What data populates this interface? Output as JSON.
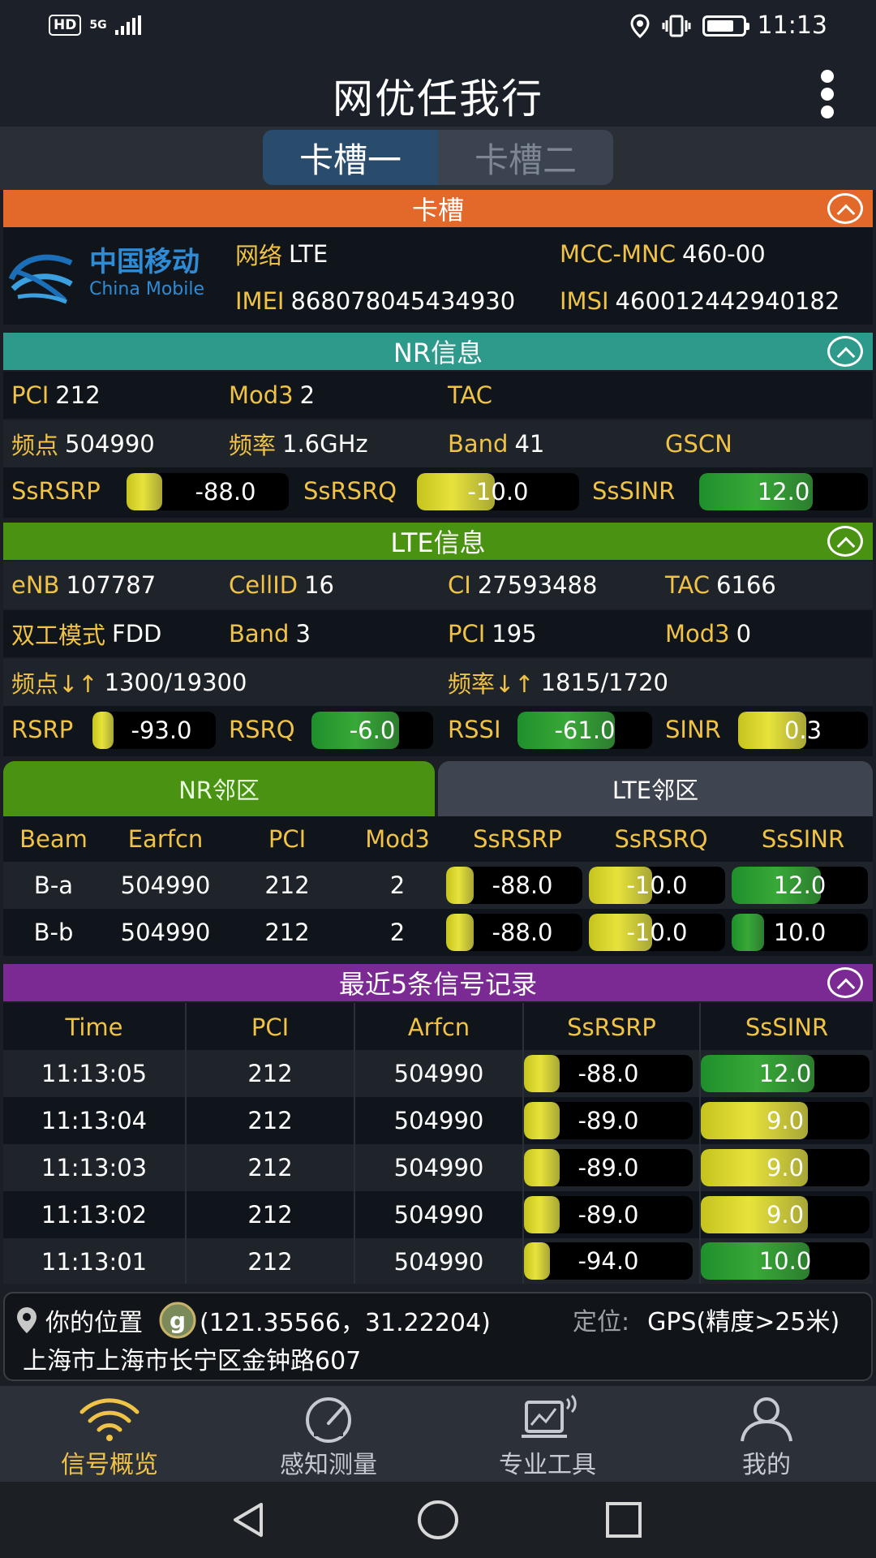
{
  "status_bar": {
    "hd": "HD",
    "network": "5G",
    "time": "11:13"
  },
  "app": {
    "title": "网优任我行"
  },
  "sim_tabs": [
    "卡槽一",
    "卡槽二"
  ],
  "sim_section": {
    "title": "卡槽",
    "logo": {
      "cn": "中国移动",
      "en": "China Mobile"
    },
    "network_label": "网络",
    "network_value": "LTE",
    "mcc_label": "MCC-MNC",
    "mcc_value": "460-00",
    "imei_label": "IMEI",
    "imei_value": "868078045434930",
    "imsi_label": "IMSI",
    "imsi_value": "460012442940182"
  },
  "nr_section": {
    "title": "NR信息",
    "pci_label": "PCI",
    "pci_value": "212",
    "mod3_label": "Mod3",
    "mod3_value": "2",
    "tac_label": "TAC",
    "tac_value": "",
    "freq_point_label": "频点",
    "freq_point_value": "504990",
    "freq_label": "频率",
    "freq_value": "1.6GHz",
    "band_label": "Band",
    "band_value": "41",
    "gscn_label": "GSCN",
    "gscn_value": "",
    "ssrsrp_label": "SsRSRP",
    "ssrsrp_value": "-88.0",
    "ssrsrq_label": "SsRSRQ",
    "ssrsrq_value": "-10.0",
    "sssinr_label": "SsSINR",
    "sssinr_value": "12.0"
  },
  "lte_section": {
    "title": "LTE信息",
    "enb_label": "eNB",
    "enb_value": "107787",
    "cellid_label": "CellID",
    "cellid_value": "16",
    "ci_label": "CI",
    "ci_value": "27593488",
    "tac_label": "TAC",
    "tac_value": "6166",
    "duplex_label": "双工模式",
    "duplex_value": "FDD",
    "band_label": "Band",
    "band_value": "3",
    "pci_label": "PCI",
    "pci_value": "195",
    "mod3_label": "Mod3",
    "mod3_value": "0",
    "earfcn_label": "频点↓↑",
    "earfcn_value": "1300/19300",
    "freq_label": "频率↓↑",
    "freq_value": "1815/1720",
    "rsrp_label": "RSRP",
    "rsrp_value": "-93.0",
    "rsrq_label": "RSRQ",
    "rsrq_value": "-6.0",
    "rssi_label": "RSSI",
    "rssi_value": "-61.0",
    "sinr_label": "SINR",
    "sinr_value": "0.3"
  },
  "neighbor_tabs": [
    "NR邻区",
    "LTE邻区"
  ],
  "neighbor_table": {
    "headers": [
      "Beam",
      "Earfcn",
      "PCI",
      "Mod3",
      "SsRSRP",
      "SsRSRQ",
      "SsSINR"
    ],
    "rows": [
      [
        "B-a",
        "504990",
        "212",
        "2",
        "-88.0",
        "-10.0",
        "12.0"
      ],
      [
        "B-b",
        "504990",
        "212",
        "2",
        "-88.0",
        "-10.0",
        "10.0"
      ]
    ]
  },
  "records_section": {
    "title": "最近5条信号记录",
    "headers": [
      "Time",
      "PCI",
      "Arfcn",
      "SsRSRP",
      "SsSINR"
    ],
    "rows": [
      [
        "11:13:05",
        "212",
        "504990",
        "-88.0",
        "12.0"
      ],
      [
        "11:13:04",
        "212",
        "504990",
        "-89.0",
        "9.0"
      ],
      [
        "11:13:03",
        "212",
        "504990",
        "-89.0",
        "9.0"
      ],
      [
        "11:13:02",
        "212",
        "504990",
        "-89.0",
        "9.0"
      ],
      [
        "11:13:01",
        "212",
        "504990",
        "-94.0",
        "10.0"
      ]
    ]
  },
  "location": {
    "label": "你的位置",
    "coords": "(121.35566，31.22204)",
    "method_label": "定位:",
    "method_value": "GPS(精度>25米)",
    "address": "上海市上海市长宁区金钟路607"
  },
  "bottom_nav": [
    "信号概览",
    "感知测量",
    "专业工具",
    "我的"
  ],
  "colors": {
    "accent_orange": "#e2692a",
    "nr_teal": "#2e9a8c",
    "lte_green": "#4a9212",
    "records_purple": "#7a2a92",
    "label_gold": "#f0c245",
    "nav_active": "#f0c245"
  }
}
